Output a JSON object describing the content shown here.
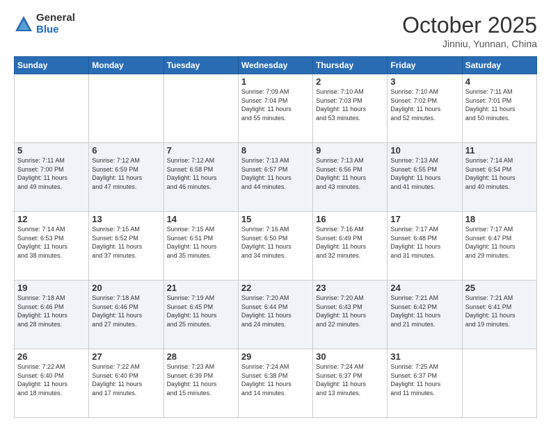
{
  "logo": {
    "general": "General",
    "blue": "Blue"
  },
  "header": {
    "month": "October 2025",
    "location": "Jinniu, Yunnan, China"
  },
  "weekdays": [
    "Sunday",
    "Monday",
    "Tuesday",
    "Wednesday",
    "Thursday",
    "Friday",
    "Saturday"
  ],
  "weeks": [
    [
      {
        "day": "",
        "info": ""
      },
      {
        "day": "",
        "info": ""
      },
      {
        "day": "",
        "info": ""
      },
      {
        "day": "1",
        "info": "Sunrise: 7:09 AM\nSunset: 7:04 PM\nDaylight: 11 hours\nand 55 minutes."
      },
      {
        "day": "2",
        "info": "Sunrise: 7:10 AM\nSunset: 7:03 PM\nDaylight: 11 hours\nand 53 minutes."
      },
      {
        "day": "3",
        "info": "Sunrise: 7:10 AM\nSunset: 7:02 PM\nDaylight: 11 hours\nand 52 minutes."
      },
      {
        "day": "4",
        "info": "Sunrise: 7:11 AM\nSunset: 7:01 PM\nDaylight: 11 hours\nand 50 minutes."
      }
    ],
    [
      {
        "day": "5",
        "info": "Sunrise: 7:11 AM\nSunset: 7:00 PM\nDaylight: 11 hours\nand 49 minutes."
      },
      {
        "day": "6",
        "info": "Sunrise: 7:12 AM\nSunset: 6:59 PM\nDaylight: 11 hours\nand 47 minutes."
      },
      {
        "day": "7",
        "info": "Sunrise: 7:12 AM\nSunset: 6:58 PM\nDaylight: 11 hours\nand 46 minutes."
      },
      {
        "day": "8",
        "info": "Sunrise: 7:13 AM\nSunset: 6:57 PM\nDaylight: 11 hours\nand 44 minutes."
      },
      {
        "day": "9",
        "info": "Sunrise: 7:13 AM\nSunset: 6:56 PM\nDaylight: 11 hours\nand 43 minutes."
      },
      {
        "day": "10",
        "info": "Sunrise: 7:13 AM\nSunset: 6:55 PM\nDaylight: 11 hours\nand 41 minutes."
      },
      {
        "day": "11",
        "info": "Sunrise: 7:14 AM\nSunset: 6:54 PM\nDaylight: 11 hours\nand 40 minutes."
      }
    ],
    [
      {
        "day": "12",
        "info": "Sunrise: 7:14 AM\nSunset: 6:53 PM\nDaylight: 11 hours\nand 38 minutes."
      },
      {
        "day": "13",
        "info": "Sunrise: 7:15 AM\nSunset: 6:52 PM\nDaylight: 11 hours\nand 37 minutes."
      },
      {
        "day": "14",
        "info": "Sunrise: 7:15 AM\nSunset: 6:51 PM\nDaylight: 11 hours\nand 35 minutes."
      },
      {
        "day": "15",
        "info": "Sunrise: 7:16 AM\nSunset: 6:50 PM\nDaylight: 11 hours\nand 34 minutes."
      },
      {
        "day": "16",
        "info": "Sunrise: 7:16 AM\nSunset: 6:49 PM\nDaylight: 11 hours\nand 32 minutes."
      },
      {
        "day": "17",
        "info": "Sunrise: 7:17 AM\nSunset: 6:48 PM\nDaylight: 11 hours\nand 31 minutes."
      },
      {
        "day": "18",
        "info": "Sunrise: 7:17 AM\nSunset: 6:47 PM\nDaylight: 11 hours\nand 29 minutes."
      }
    ],
    [
      {
        "day": "19",
        "info": "Sunrise: 7:18 AM\nSunset: 6:46 PM\nDaylight: 11 hours\nand 28 minutes."
      },
      {
        "day": "20",
        "info": "Sunrise: 7:18 AM\nSunset: 6:46 PM\nDaylight: 11 hours\nand 27 minutes."
      },
      {
        "day": "21",
        "info": "Sunrise: 7:19 AM\nSunset: 6:45 PM\nDaylight: 11 hours\nand 25 minutes."
      },
      {
        "day": "22",
        "info": "Sunrise: 7:20 AM\nSunset: 6:44 PM\nDaylight: 11 hours\nand 24 minutes."
      },
      {
        "day": "23",
        "info": "Sunrise: 7:20 AM\nSunset: 6:43 PM\nDaylight: 11 hours\nand 22 minutes."
      },
      {
        "day": "24",
        "info": "Sunrise: 7:21 AM\nSunset: 6:42 PM\nDaylight: 11 hours\nand 21 minutes."
      },
      {
        "day": "25",
        "info": "Sunrise: 7:21 AM\nSunset: 6:41 PM\nDaylight: 11 hours\nand 19 minutes."
      }
    ],
    [
      {
        "day": "26",
        "info": "Sunrise: 7:22 AM\nSunset: 6:40 PM\nDaylight: 11 hours\nand 18 minutes."
      },
      {
        "day": "27",
        "info": "Sunrise: 7:22 AM\nSunset: 6:40 PM\nDaylight: 11 hours\nand 17 minutes."
      },
      {
        "day": "28",
        "info": "Sunrise: 7:23 AM\nSunset: 6:39 PM\nDaylight: 11 hours\nand 15 minutes."
      },
      {
        "day": "29",
        "info": "Sunrise: 7:24 AM\nSunset: 6:38 PM\nDaylight: 11 hours\nand 14 minutes."
      },
      {
        "day": "30",
        "info": "Sunrise: 7:24 AM\nSunset: 6:37 PM\nDaylight: 11 hours\nand 13 minutes."
      },
      {
        "day": "31",
        "info": "Sunrise: 7:25 AM\nSunset: 6:37 PM\nDaylight: 11 hours\nand 11 minutes."
      },
      {
        "day": "",
        "info": ""
      }
    ]
  ]
}
